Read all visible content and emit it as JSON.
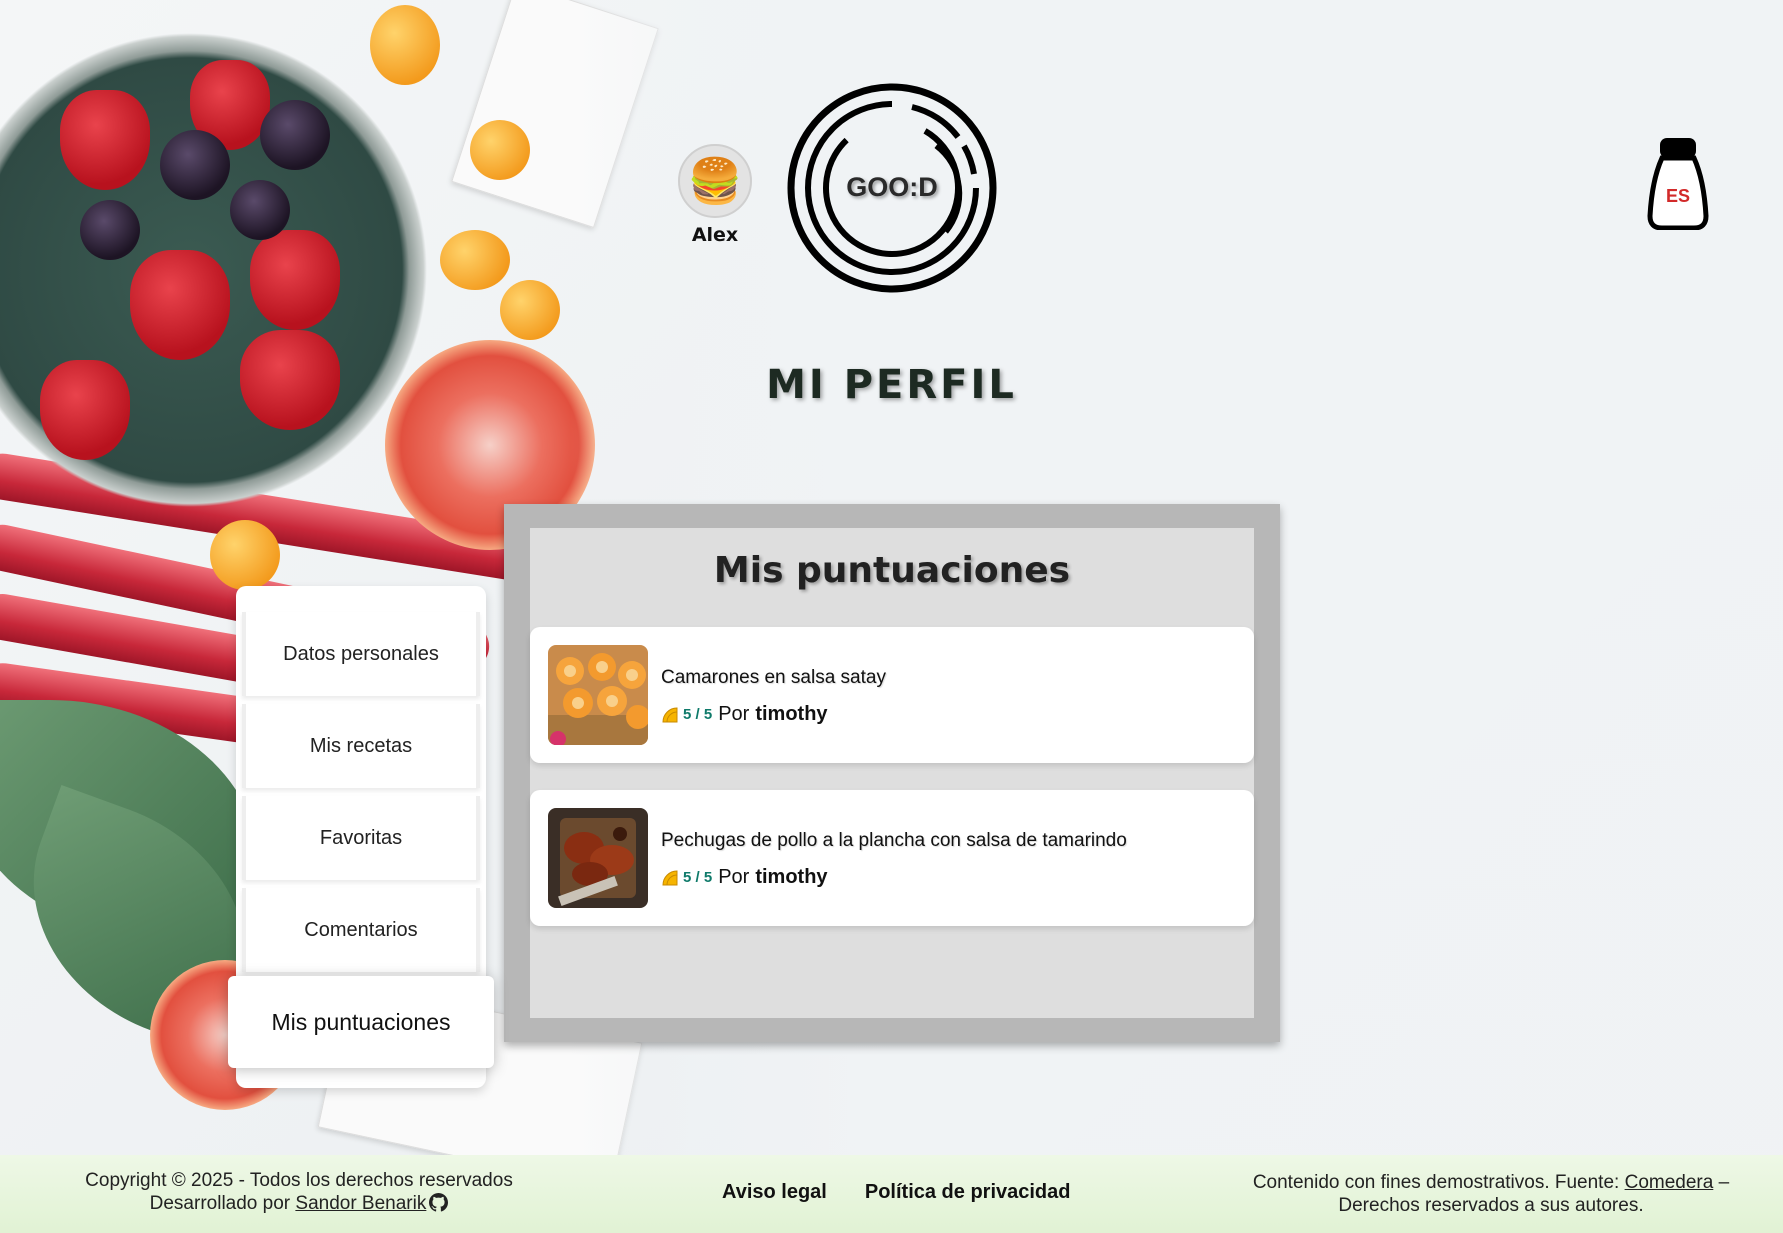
{
  "user": {
    "name": "Alex",
    "avatar_icon": "burger-icon"
  },
  "logo": {
    "text": "GOO:D"
  },
  "language": {
    "code": "ES"
  },
  "page": {
    "title": "MI PERFIL"
  },
  "menu": {
    "items": [
      {
        "label": "Datos personales"
      },
      {
        "label": "Mis recetas"
      },
      {
        "label": "Favoritas"
      },
      {
        "label": "Comentarios"
      },
      {
        "label": "Mis puntuaciones",
        "active": true
      }
    ]
  },
  "panel": {
    "title": "Mis puntuaciones",
    "ratings": [
      {
        "recipe": "Camarones en salsa satay",
        "score": "5 / 5",
        "by_label": "Por",
        "author": "timothy"
      },
      {
        "recipe": "Pechugas de pollo a la plancha con salsa de tamarindo",
        "score": "5 / 5",
        "by_label": "Por",
        "author": "timothy"
      }
    ]
  },
  "footer": {
    "copyright": "Copyright © 2025 - Todos los derechos reservados",
    "developed_by": "Desarrollado por",
    "developer": "Sandor Benarik",
    "links": {
      "legal": "Aviso legal",
      "privacy": "Política de privacidad"
    },
    "source_text": "Contenido con fines demostrativos. Fuente:",
    "source_link": "Comedera",
    "source_suffix": "–",
    "rights_text": "Derechos reservados a sus autores."
  },
  "colors": {
    "score": "#0f7a6a",
    "lang": "#d22a2a",
    "footer_bg": "#e1f2d4"
  }
}
